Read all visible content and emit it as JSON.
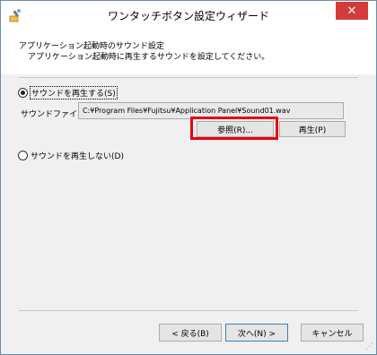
{
  "window": {
    "title": "ワンタッチボタン設定ウィザード",
    "close_label": "✕"
  },
  "header": {
    "title": "アプリケーション起動時のサウンド設定",
    "description": "アプリケーション起動時に再生するサウンドを設定してください。"
  },
  "options": {
    "play_sound": {
      "label": "サウンドを再生する(S)",
      "checked": true
    },
    "no_sound": {
      "label": "サウンドを再生しない(D)",
      "checked": false
    }
  },
  "sound_file": {
    "label": "サウンドファイル:",
    "value": "C:¥Program Files¥Fujitsu¥Application Panel¥Sound01.wav"
  },
  "buttons": {
    "browse": "参照(R)...",
    "play": "再生(P)",
    "back": "< 戻る(B)",
    "next": "次へ(N) >",
    "cancel": "キャンセル"
  },
  "colors": {
    "highlight": "#e60012",
    "close_button": "#d43b3b"
  },
  "icons": {
    "app": "wizard-app-icon",
    "close": "close-icon"
  }
}
